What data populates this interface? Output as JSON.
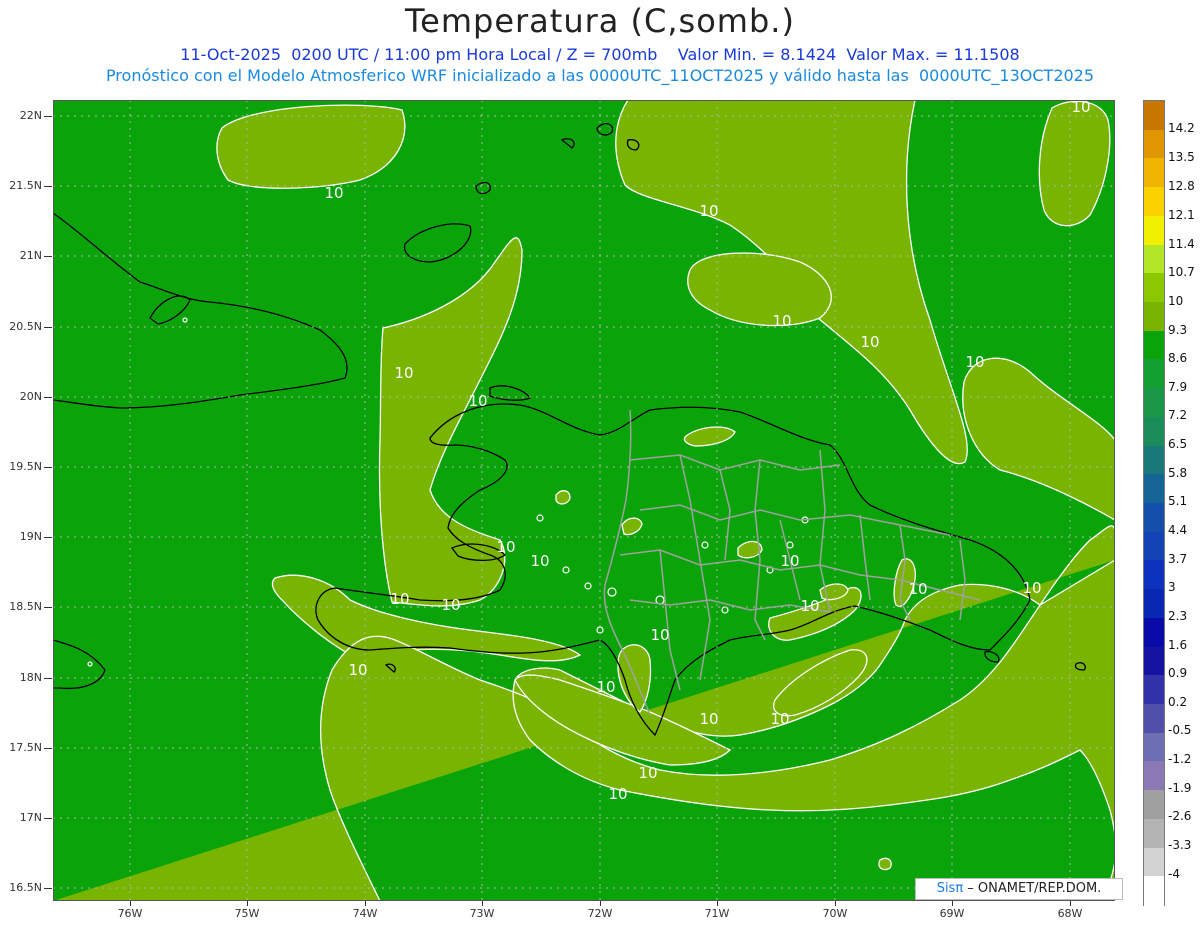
{
  "header": {
    "title": "Temperatura (C,somb.)",
    "subtitle_line1": "11-Oct-2025  0200 UTC / 11:00 pm Hora Local / Z = 700mb    Valor Min. = 8.1424  Valor Max. = 11.1508",
    "subtitle_line2": "Pronóstico con el Modelo Atmosferico WRF inicializado a las 0000UTC_11OCT2025 y válido hasta las  0000UTC_13OCT2025"
  },
  "map": {
    "lat_labels": [
      "22N",
      "21.5N",
      "21N",
      "20.5N",
      "20N",
      "19.5N",
      "19N",
      "18.5N",
      "18N",
      "17.5N",
      "17N",
      "16.5N"
    ],
    "lon_labels": [
      "76W",
      "75W",
      "74W",
      "73W",
      "72W",
      "71W",
      "70W",
      "69W",
      "68W"
    ],
    "contour_label": "10",
    "contour_label_count": 23,
    "colors": {
      "fill_below_10": "#0aa40a",
      "fill_10_to_10_7": "#78b400",
      "coast": "#000000",
      "province_borders": "#a0a0a0",
      "contour_line": "#ffffff"
    }
  },
  "colorbar": {
    "labels": [
      "14.2",
      "13.5",
      "12.8",
      "12.1",
      "11.4",
      "10.7",
      "10",
      "9.3",
      "8.6",
      "7.9",
      "7.2",
      "6.5",
      "5.8",
      "5.1",
      "4.4",
      "3.7",
      "3",
      "2.3",
      "1.6",
      "0.9",
      "0.2",
      "-0.5",
      "-1.2",
      "-1.9",
      "-2.6",
      "-3.3",
      "-4"
    ],
    "colors": [
      "#c87800",
      "#e09600",
      "#f0b400",
      "#fad200",
      "#f0f000",
      "#b4e628",
      "#8cc800",
      "#78b400",
      "#0aa40a",
      "#14a030",
      "#199646",
      "#198c5a",
      "#197878",
      "#146496",
      "#1450aa",
      "#1444b4",
      "#0c32be",
      "#0828b4",
      "#0a0aaa",
      "#1414a0",
      "#3232aa",
      "#5050aa",
      "#6e6eb4",
      "#8c78b4",
      "#a0a0a0",
      "#b4b4b4",
      "#d2d2d2",
      "#ffffff"
    ]
  },
  "credit": {
    "brand": "Sisπ",
    "text": " – ONAMET/REP.DOM."
  }
}
